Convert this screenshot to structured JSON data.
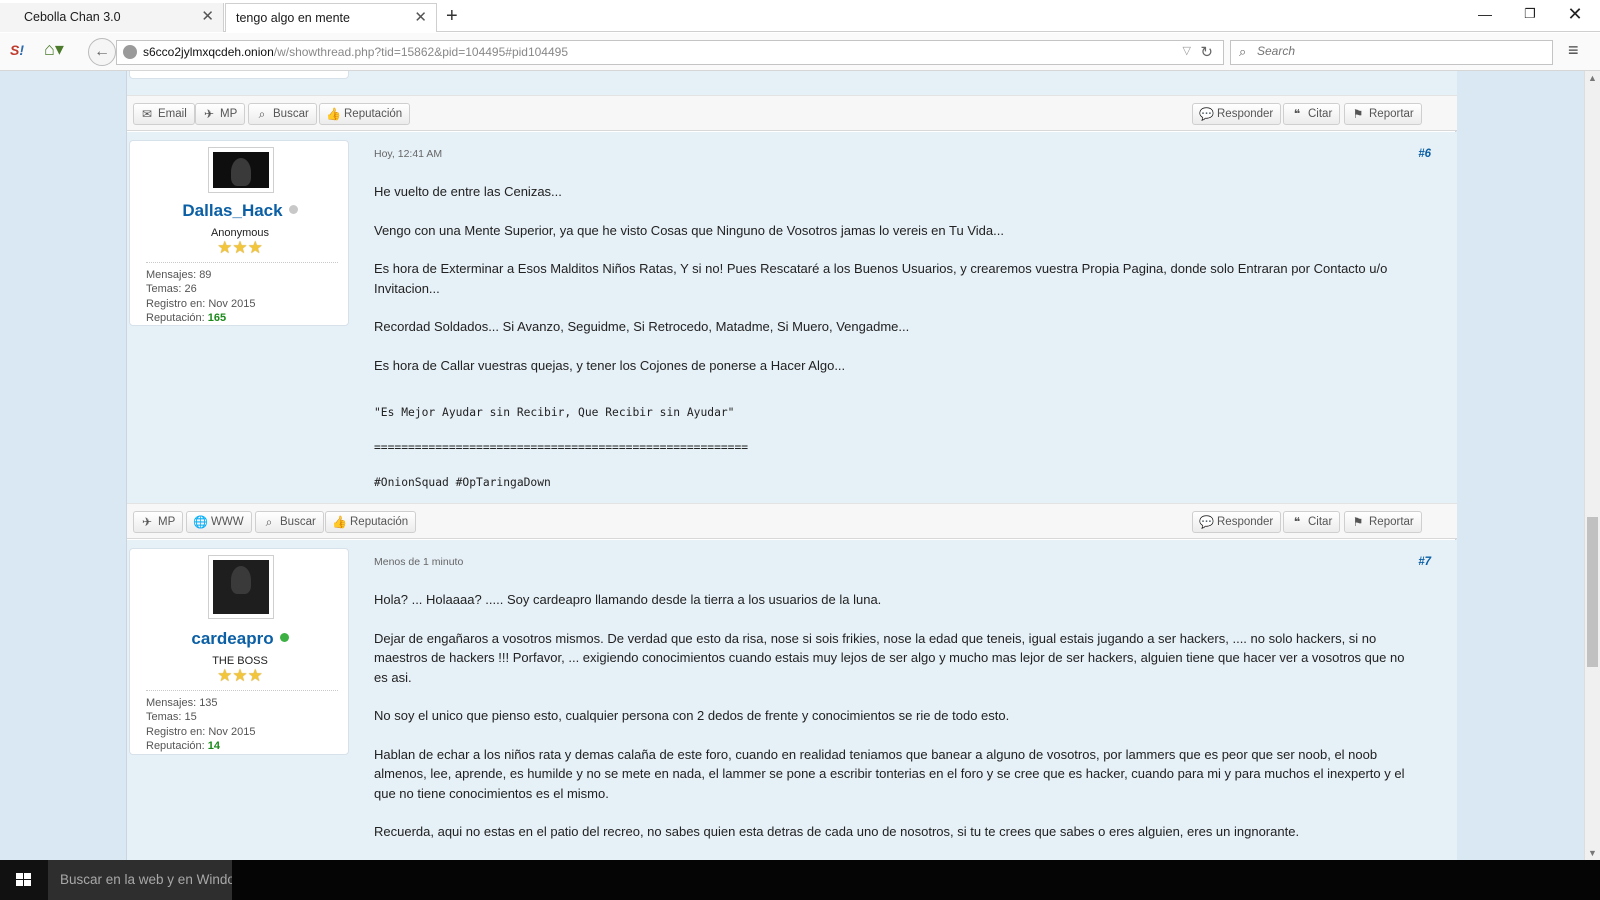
{
  "browser": {
    "tabs": [
      {
        "title": "Cebolla Chan 3.0",
        "active": false
      },
      {
        "title": "tengo algo en mente",
        "active": true
      }
    ],
    "new_tab": "+",
    "url_host": "s6cco2jylmxqcdeh.onion",
    "url_path": "/w/showthread.php?tid=15862&pid=104495#pid104495",
    "search_placeholder": "Search",
    "window_controls": {
      "minimize": "—",
      "maximize": "❐",
      "close": "✕"
    }
  },
  "toolbar_top": {
    "left": [
      "Email",
      "MP",
      "Buscar",
      "Reputación"
    ],
    "right": [
      "Responder",
      "Citar",
      "Reportar"
    ]
  },
  "posts": [
    {
      "author": {
        "name": "Dallas_Hack",
        "status": "offline",
        "title": "Anonymous",
        "stars": "★★★",
        "stats": {
          "mensajes": "Mensajes: 89",
          "temas": "Temas: 26",
          "registro": "Registro en: Nov 2015",
          "reputacion_label": "Reputación:",
          "reputacion_value": "165"
        }
      },
      "time": "Hoy, 12:41 AM",
      "number": "#6",
      "paragraphs": [
        "He vuelto de entre las Cenizas...",
        "Vengo con una Mente Superior, ya que he visto Cosas que Ninguno de Vosotros jamas lo vereis en Tu Vida...",
        "Es hora de Exterminar a Esos Malditos Niños Ratas, Y si no! Pues Rescataré a los Buenos Usuarios, y crearemos vuestra Propia Pagina, donde solo Entraran por Contacto u/o Invitacion...",
        "Recordad Soldados... Si Avanzo, Seguidme, Si Retrocedo, Matadme, Si Muero, Vengadme...",
        "Es hora de Callar vuestras quejas, y tener los Cojones de ponerse a Hacer Algo..."
      ],
      "signature": [
        "\"Es Mejor Ayudar sin Recibir, Que Recibir sin Ayudar\"",
        "=======================================================",
        "#OnionSquad #OpTaringaDown"
      ],
      "actions_left": [
        "MP",
        "WWW",
        "Buscar",
        "Reputación"
      ],
      "actions_right": [
        "Responder",
        "Citar",
        "Reportar"
      ]
    },
    {
      "author": {
        "name": "cardeapro",
        "status": "online",
        "title": "THE BOSS",
        "stars": "★★★",
        "stats": {
          "mensajes": "Mensajes: 135",
          "temas": "Temas: 15",
          "registro": "Registro en: Nov 2015",
          "reputacion_label": "Reputación:",
          "reputacion_value": "14"
        }
      },
      "time": "Menos de 1 minuto",
      "number": "#7",
      "paragraphs": [
        "Hola? ... Holaaaa? ..... Soy cardeapro llamando desde la tierra a los usuarios de la luna.",
        "Dejar de engañaros a vosotros mismos. De verdad que esto da risa, nose si sois frikies, nose la edad que teneis, igual estais jugando a ser hackers, .... no solo hackers, si no maestros de hackers !!! Porfavor, ... exigiendo conocimientos cuando estais muy lejos de ser algo y mucho mas lejor de ser hackers, alguien tiene que hacer ver a vosotros que no es asi.",
        "No soy el unico que pienso esto, cualquier persona con 2 dedos de frente y conocimientos se rie de todo esto.",
        "Hablan de echar a los niños rata y demas calaña de este foro, cuando en realidad teniamos que banear a alguno de vosotros, por lammers que es peor que ser noob, el noob almenos, lee, aprende, es humilde y no se mete en nada, el lammer se pone a escribir tonterias en el foro y se cree que es hacker, cuando para mi y para muchos el inexperto y el que no tiene conocimientos es el mismo.",
        "Recuerda, aqui no estas en el patio del recreo, no sabes quien esta detras de cada uno de nosotros, si tu te crees que sabes o eres alguien, eres un ingnorante."
      ]
    }
  ],
  "taskbar": {
    "search_placeholder": "Buscar en la web y en Windows"
  },
  "colors": {
    "username": "#0b5fa5",
    "online": "#3cb043",
    "offline": "#c8c8c8",
    "reputation": "#1a8a1a",
    "post_bg": "#e6f0f7"
  }
}
